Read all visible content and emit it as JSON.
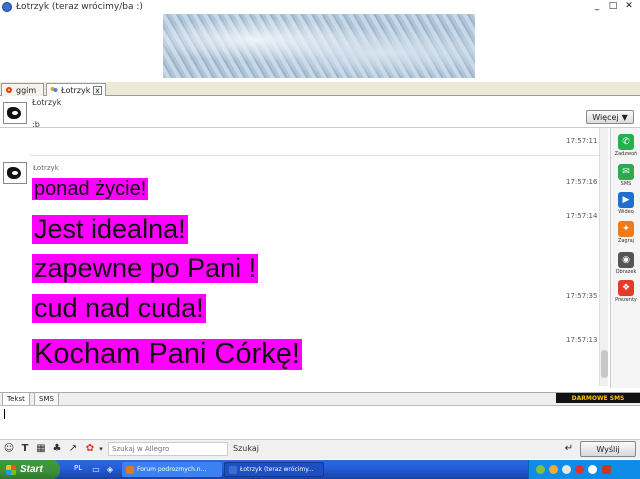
{
  "window": {
    "title": "Łotrzyk (teraz wrócimy/ba :)",
    "minimize_glyph": "_",
    "maximize_glyph": "□",
    "close_glyph": "✕"
  },
  "tabs": [
    {
      "label": "ggim",
      "icon": "gg-flower-icon"
    },
    {
      "label": "Łotrzyk",
      "icon": "user-multi-icon",
      "close": "x"
    }
  ],
  "contact": {
    "nick": "Łotrzyk",
    "status": ":b"
  },
  "more_button": {
    "label": "Więcej",
    "arrow": "▼"
  },
  "chat": {
    "first_timestamp": "17:57:11",
    "message_author": "Łotrzyk",
    "messages": [
      {
        "text": "ponad życie!",
        "time": "17:57:16"
      },
      {
        "text": "Jest idealna!",
        "time": "17:57:14"
      },
      {
        "text": "zapewne po Pani !",
        "time": ""
      },
      {
        "text": "cud nad cuda!",
        "time": "17:57:35"
      },
      {
        "text": "Kocham Pani Córkę!",
        "time": "17:57:13"
      }
    ],
    "message_color": "#ff00ff"
  },
  "sidebar": [
    {
      "label": "Zadzwoń",
      "icon": "phone-icon",
      "color": "#22b14c",
      "glyph": "✆"
    },
    {
      "label": "SMS",
      "icon": "sms-icon",
      "color": "#2fa84f",
      "glyph": "✉"
    },
    {
      "label": "Wideo",
      "icon": "video-icon",
      "color": "#1f6fd1",
      "glyph": "▶"
    },
    {
      "label": "Zagraj",
      "icon": "game-icon",
      "color": "#f07a1a",
      "glyph": "✦"
    },
    {
      "label": "Obrazek",
      "icon": "camera-icon",
      "color": "#555555",
      "glyph": "◉"
    },
    {
      "label": "Prezenty",
      "icon": "gift-icon",
      "color": "#e43b2a",
      "glyph": "❖"
    }
  ],
  "input": {
    "tabs": [
      "Tekst",
      "SMS"
    ],
    "promo": "DARMOWE SMS"
  },
  "toolbar": {
    "search_placeholder": "Szukaj w Allegro",
    "search_label": "Szukaj",
    "enter_glyph": "↵",
    "send_label": "Wyślij"
  },
  "taskbar": {
    "start_label": "Start",
    "language": "PL",
    "tasks": [
      {
        "label": "Forum podrozmych.n...",
        "icon": "browser-icon",
        "color": "#e07b1a"
      },
      {
        "label": "Łotrzyk (teraz wrócimy...",
        "icon": "gg-icon",
        "color": "#3a6fd1"
      }
    ]
  }
}
